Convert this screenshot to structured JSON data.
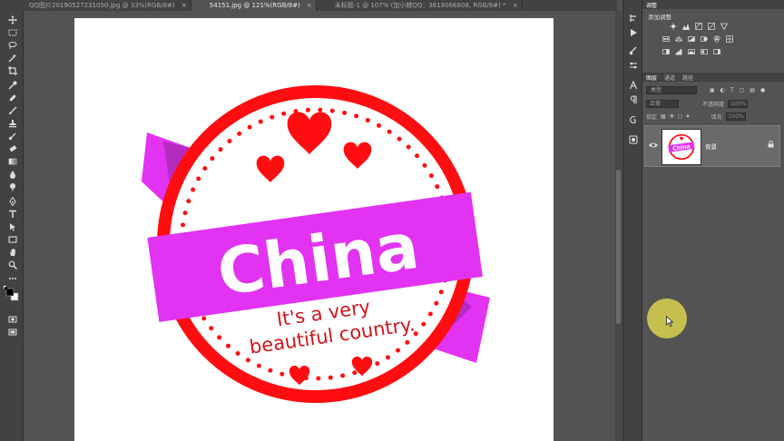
{
  "tabs": [
    {
      "label": "QQ图片20190527231050.jpg @ 33%(RGB/8#)",
      "close": "×",
      "active": false
    },
    {
      "label": "54151.jpg @ 121%(RGB/8#)",
      "close": "×",
      "active": true
    },
    {
      "label": "未标题-1 @ 107% (加小越QQ：3618066808, RGB/8#) *",
      "close": "×",
      "active": false
    }
  ],
  "artwork": {
    "main_text": "China",
    "line1": "It's a very",
    "line2": "beautiful country.",
    "colors": {
      "red": "#ff0d10",
      "magenta": "#e232f2",
      "ribbon_dark": "#b32bbf",
      "white": "#ffffff"
    }
  },
  "adjustments": {
    "tab_label": "调整",
    "title": "添加调整"
  },
  "layers": {
    "tabs": [
      "图层",
      "通道",
      "路径"
    ],
    "filter_label": "类型",
    "blend_mode": "正常",
    "opacity_label": "不透明度",
    "opacity_value": "100%",
    "lock_label": "锁定",
    "fill_label": "填充",
    "fill_value": "100%",
    "layer_name": "背景",
    "thumb_text": "China"
  }
}
